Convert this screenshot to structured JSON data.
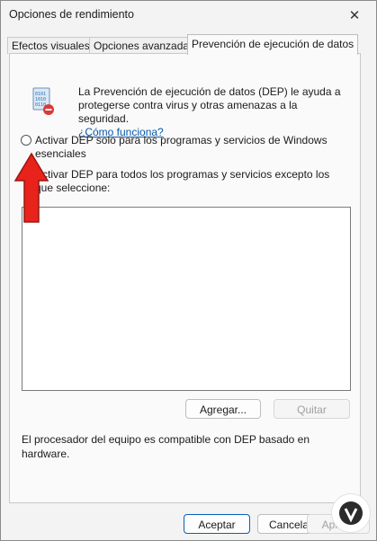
{
  "window": {
    "title": "Opciones de rendimiento",
    "close_glyph": "✕"
  },
  "tabs": [
    {
      "label": "Efectos visuales",
      "active": false
    },
    {
      "label": "Opciones avanzadas",
      "active": false
    },
    {
      "label": "Prevención de ejecución de datos",
      "active": true
    }
  ],
  "intro": {
    "icon": "dep-shield-icon",
    "text": "La Prevención de ejecución de datos (DEP) le ayuda a protegerse contra virus y otras amenazas a la seguridad.",
    "link": "¿Cómo funciona?"
  },
  "options": [
    {
      "label": "Activar DEP solo para los programas y servicios de Windows esenciales",
      "checked": false
    },
    {
      "label": "Activar DEP para todos los programas y servicios excepto los que seleccione:",
      "checked": true
    }
  ],
  "exceptions_list": [],
  "list_buttons": {
    "add": "Agregar...",
    "remove": "Quitar"
  },
  "footnote": "El procesador del equipo es compatible con DEP basado en hardware.",
  "dialog_buttons": {
    "ok": "Aceptar",
    "cancel": "Cancelar",
    "apply": "Aplicar"
  },
  "colors": {
    "accent": "#0a5fb4",
    "link": "#0a5aa8",
    "arrow": "#e8231c"
  }
}
